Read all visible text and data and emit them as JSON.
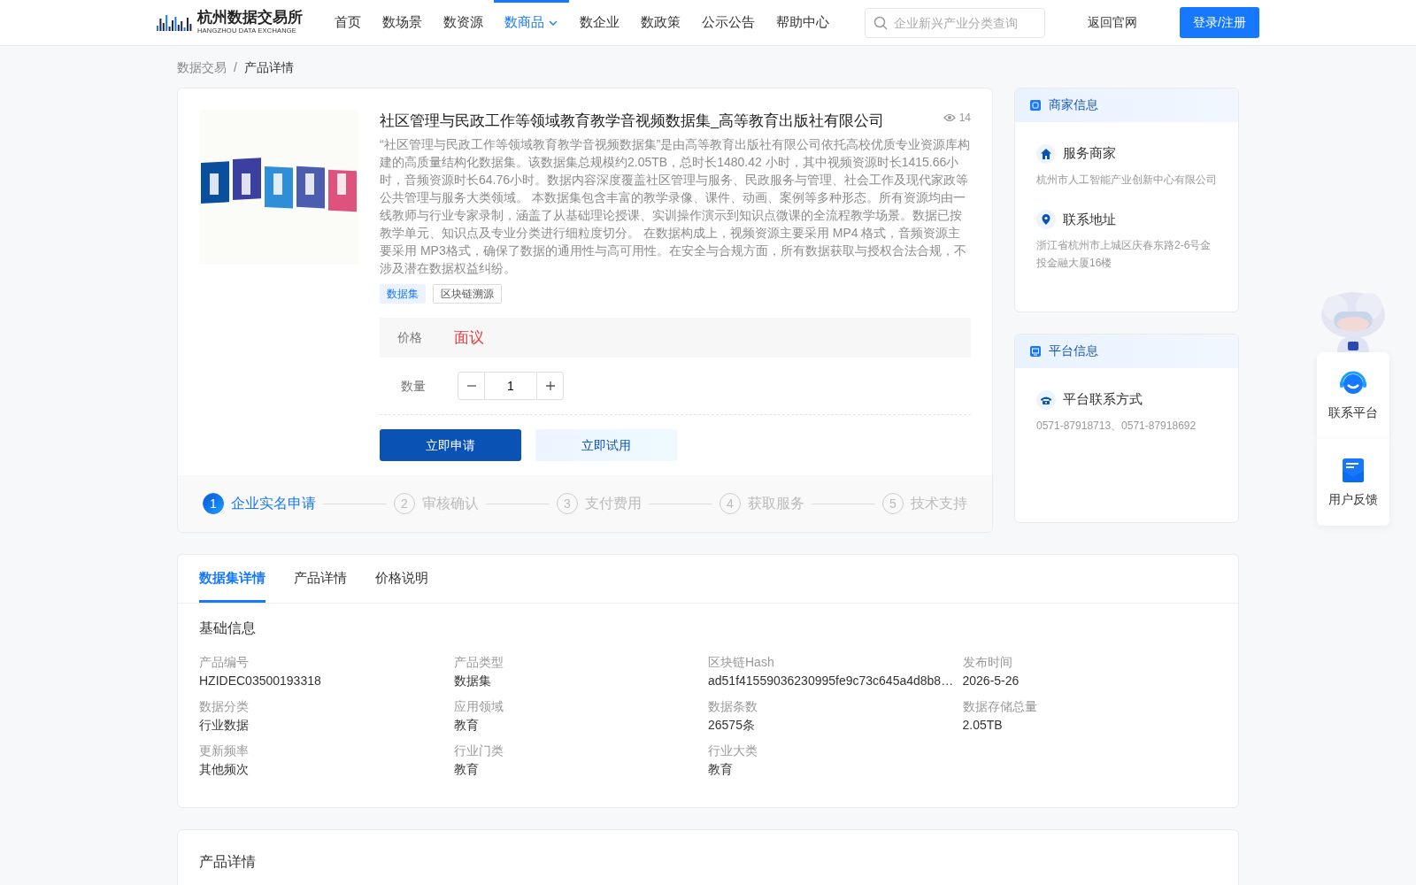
{
  "header": {
    "logo": {
      "title": "杭州数据交易所",
      "subtitle": "HANGZHOU DATA EXCHANGE"
    },
    "nav": [
      {
        "label": "首页",
        "selected": false,
        "dropdown": false
      },
      {
        "label": "数场景",
        "selected": false,
        "dropdown": false
      },
      {
        "label": "数资源",
        "selected": false,
        "dropdown": false
      },
      {
        "label": "数商品",
        "selected": true,
        "dropdown": true
      },
      {
        "label": "数企业",
        "selected": false,
        "dropdown": false
      },
      {
        "label": "数政策",
        "selected": false,
        "dropdown": false
      },
      {
        "label": "公示公告",
        "selected": false,
        "dropdown": false
      },
      {
        "label": "帮助中心",
        "selected": false,
        "dropdown": false
      }
    ],
    "search": {
      "placeholder": "企业新兴产业分类查询"
    },
    "back_link": "返回官网",
    "login": "登录/注册"
  },
  "breadcrumb": [
    "数据交易",
    "产品详情"
  ],
  "breadcrumb_separator": "/",
  "product": {
    "title": "社区管理与民政工作等领域教育教学音视频数据集_高等教育出版社有限公司",
    "views": "14",
    "description": "“社区管理与民政工作等领域教育教学音视频数据集”是由高等教育出版社有限公司依托高校优质专业资源库构建的高质量结构化数据集。该数据集总规模约2.05TB，总时长1480.42 小时，其中视频资源时长1415.66小时，音频资源时长64.76小时。数据内容深度覆盖社区管理与服务、民政服务与管理、社会工作及现代家政等公共管理与服务大类领域。 本数据集包含丰富的教学录像、课件、动画、案例等多种形态。所有资源均由一线教师与行业专家录制，涵盖了从基础理论授课、实训操作演示到知识点微课的全流程教学场景。数据已按教学单元、知识点及专业分类进行细粒度切分。 在数据构成上，视频资源主要采用 MP4 格式，音频资源主要采用 MP3格式，确保了数据的通用性与高可用性。在安全与合规方面，所有数据获取与授权合法合规，不涉及潜在数据权益纠纷。",
    "tags": [
      {
        "label": "数据集",
        "kind": "primary"
      },
      {
        "label": "区块链溯源",
        "kind": "outline"
      }
    ],
    "price_label": "价格",
    "price": "面议",
    "quantity_label": "数量",
    "quantity": "1",
    "buttons": [
      {
        "label": "立即申请",
        "kind": "primary"
      },
      {
        "label": "立即试用",
        "kind": "light"
      }
    ],
    "steps": [
      {
        "number": "1",
        "label": "企业实名申请",
        "selected": true
      },
      {
        "number": "2",
        "label": "审核确认",
        "selected": false
      },
      {
        "number": "3",
        "label": "支付费用",
        "selected": false
      },
      {
        "number": "4",
        "label": "获取服务",
        "selected": false
      },
      {
        "number": "5",
        "label": "技术支持",
        "selected": false
      }
    ]
  },
  "side_panels": [
    {
      "title": "商家信息",
      "kind": "store",
      "items": [
        {
          "kind": "house",
          "title": "服务商家",
          "text": "杭州市人工智能产业创新中心有限公司"
        },
        {
          "kind": "pin",
          "title": "联系地址",
          "text": "浙江省杭州市上城区庆春东路2-6号金投金融大厦16楼"
        }
      ]
    },
    {
      "title": "平台信息",
      "kind": "monitor",
      "items": [
        {
          "kind": "phone",
          "title": "平台联系方式",
          "text": "0571-87918713、0571-87918692"
        }
      ]
    }
  ],
  "float_widget": {
    "items": [
      {
        "kind": "headset",
        "label": "联系平台"
      },
      {
        "kind": "mail",
        "label": "用户反馈"
      }
    ]
  },
  "tabs": [
    {
      "label": "数据集详情",
      "selected": true
    },
    {
      "label": "产品详情",
      "selected": false
    },
    {
      "label": "价格说明",
      "selected": false
    }
  ],
  "basic_info": {
    "title": "基础信息",
    "fields": [
      {
        "label": "产品编号",
        "value": "HZIDEC03500193318"
      },
      {
        "label": "产品类型",
        "value": "数据集"
      },
      {
        "label": "区块链Hash",
        "value": "ad51f41559036230995fe9c73c645a4d8b8…"
      },
      {
        "label": "发布时间",
        "value": "2026-5-26"
      },
      {
        "label": "数据分类",
        "value": "行业数据"
      },
      {
        "label": "应用领域",
        "value": "教育"
      },
      {
        "label": "数据条数",
        "value": "26575条"
      },
      {
        "label": "数据存储总量",
        "value": "2.05TB"
      },
      {
        "label": "更新频率",
        "value": "其他频次"
      },
      {
        "label": "行业门类",
        "value": "教育"
      },
      {
        "label": "行业大类",
        "value": "教育"
      }
    ]
  },
  "product_details": {
    "title": "产品详情"
  }
}
